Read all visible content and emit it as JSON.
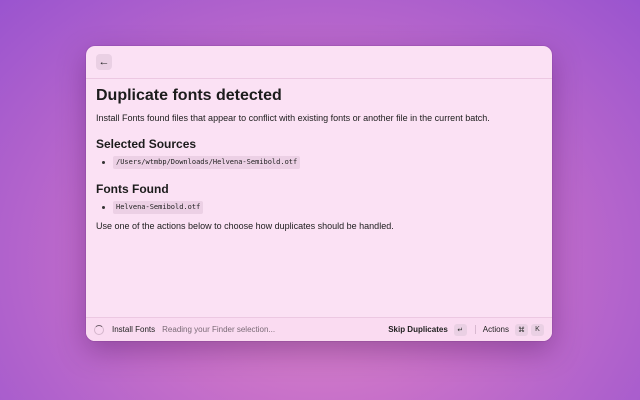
{
  "topbar": {
    "back_icon": "←"
  },
  "main": {
    "title": "Duplicate fonts detected",
    "description": "Install Fonts found files that appear to conflict with existing fonts or another file in the current batch.",
    "selected_sources_heading": "Selected Sources",
    "selected_sources": [
      "/Users/wtmbp/Downloads/Helvena-Semibold.otf"
    ],
    "fonts_found_heading": "Fonts Found",
    "fonts_found": [
      "Helvena-Semibold.otf"
    ],
    "footer_note": "Use one of the actions below to choose how duplicates should be handled."
  },
  "statusbar": {
    "app_name": "Install Fonts",
    "status_message": "Reading your Finder selection...",
    "primary_action": "Skip Duplicates",
    "primary_shortcut": "↵",
    "actions_label": "Actions",
    "actions_shortcut_1": "⌘",
    "actions_shortcut_2": "K"
  }
}
